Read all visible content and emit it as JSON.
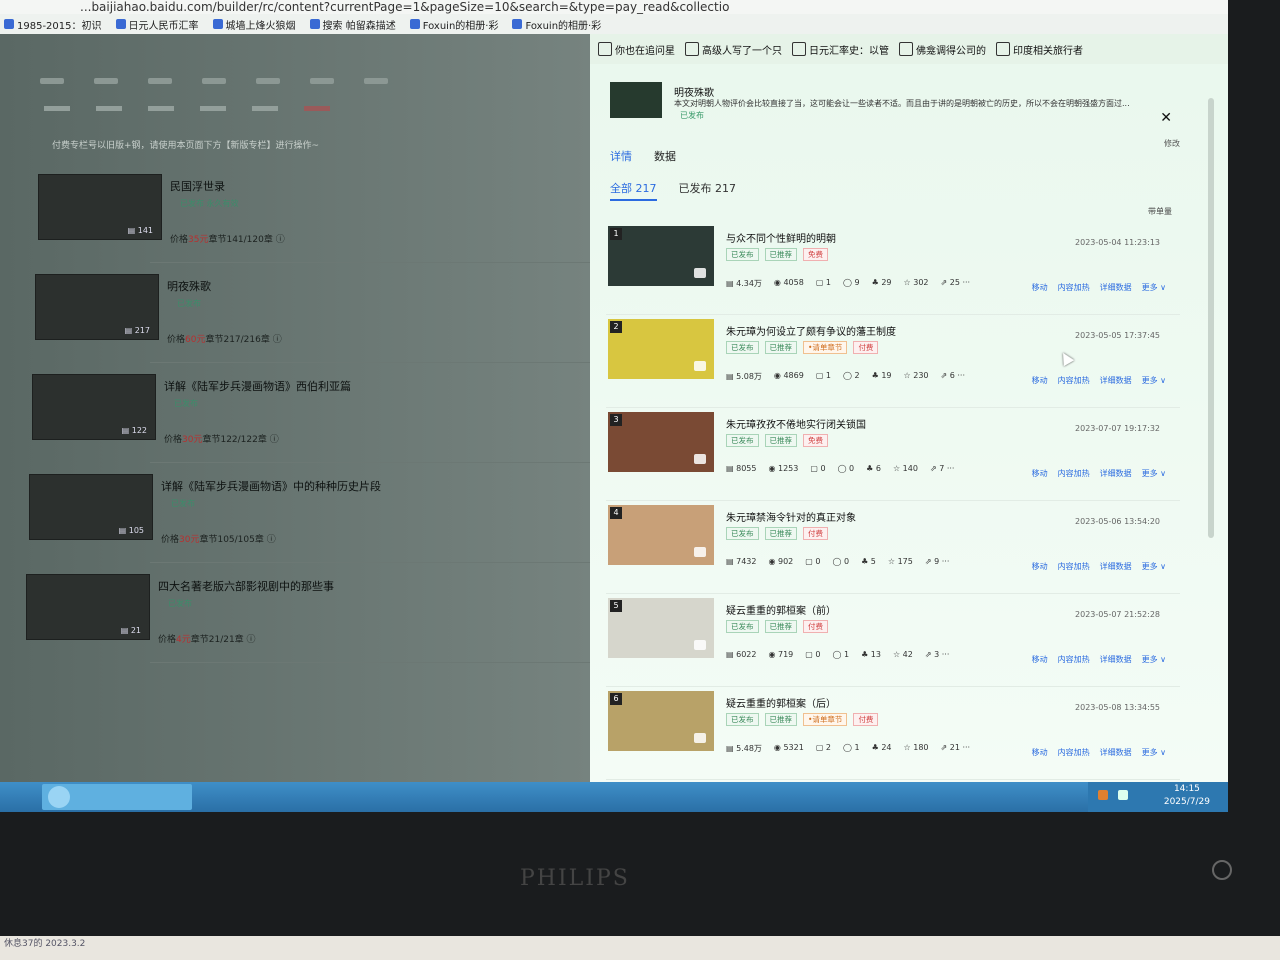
{
  "browser": {
    "url": "...baijiahao.baidu.com/builder/rc/content?currentPage=1&pageSize=10&search=&type=pay_read&collectio",
    "bookmarks": [
      "1985-2015：初识",
      "日元人民币汇率",
      "城墙上烽火狼烟",
      "搜索 帕留森描述",
      "Foxuin的相册·彩",
      "Foxuin的相册·彩"
    ],
    "toolbar_items": [
      "你也在追问星",
      "高级人写了一个只",
      "日元汇率史：以管",
      "佛龛调得公司的",
      "印度相关旅行者"
    ]
  },
  "left": {
    "hint": "付费专栏号以旧版+钢，请使用本页面下方【新版专栏】进行操作~",
    "books": [
      {
        "title": "民国浮世录",
        "status": "已发布",
        "status2": "永久有效",
        "price_prefix": "价格",
        "price": "35元",
        "chapters": "章节141/120章",
        "count": "141"
      },
      {
        "title": "明夜殊歌",
        "status": "已发布",
        "price_prefix": "价格",
        "price": "60元",
        "chapters": "章节217/216章",
        "count": "217"
      },
      {
        "title": "详解《陆军步兵漫画物语》西伯利亚篇",
        "status": "已发布",
        "price_prefix": "价格",
        "price": "30元",
        "chapters": "章节122/122章",
        "count": "122"
      },
      {
        "title": "详解《陆军步兵漫画物语》中的种种历史片段",
        "status": "已发布",
        "price_prefix": "价格",
        "price": "30元",
        "chapters": "章节105/105章",
        "count": "105"
      },
      {
        "title": "四大名著老版六部影视剧中的那些事",
        "status": "已发布",
        "price_prefix": "价格",
        "price": "4元",
        "chapters": "章节21/21章",
        "count": "21"
      }
    ]
  },
  "panel": {
    "title": "明夜殊歌",
    "desc": "本文对明朝人物评价会比较直接了当，这可能会让一些读者不适。而且由于讲的是明朝被亡的历史，所以不会在明朝强盛方面过...",
    "badge": "已发布",
    "edit": "修改",
    "tabs": [
      "详情",
      "数据"
    ],
    "filters": [
      "全部 217",
      "已发布 217"
    ],
    "sort": "带单量",
    "actions": [
      "移动",
      "内容加热",
      "详细数据",
      "更多 ∨"
    ],
    "articles": [
      {
        "idx": "1",
        "title": "与众不同个性鲜明的明朝",
        "tags": [
          "已发布",
          "已推荐",
          "免费"
        ],
        "date": "2023-05-04 11:23:13",
        "stats": [
          "4.34万",
          "4058",
          "1",
          "9",
          "29",
          "302",
          "25 ···"
        ],
        "thumb": "#2c3a36"
      },
      {
        "idx": "2",
        "title": "朱元璋为何设立了颇有争议的藩王制度",
        "tags": [
          "已发布",
          "已推荐",
          "•请单章节",
          "付费"
        ],
        "date": "2023-05-05 17:37:45",
        "stats": [
          "5.08万",
          "4869",
          "1",
          "2",
          "19",
          "230",
          "6 ···"
        ],
        "thumb": "#d8c640"
      },
      {
        "idx": "3",
        "title": "朱元璋孜孜不倦地实行闭关锁国",
        "tags": [
          "已发布",
          "已推荐",
          "免费"
        ],
        "date": "2023-07-07 19:17:32",
        "stats": [
          "8055",
          "1253",
          "0",
          "0",
          "6",
          "140",
          "7 ···"
        ],
        "thumb": "#7a4a34"
      },
      {
        "idx": "4",
        "title": "朱元璋禁海令针对的真正对象",
        "tags": [
          "已发布",
          "已推荐",
          "付费"
        ],
        "date": "2023-05-06 13:54:20",
        "stats": [
          "7432",
          "902",
          "0",
          "0",
          "5",
          "175",
          "9 ···"
        ],
        "thumb": "#c8a078"
      },
      {
        "idx": "5",
        "title": "疑云重重的郭桓案（前）",
        "tags": [
          "已发布",
          "已推荐",
          "付费"
        ],
        "date": "2023-05-07 21:52:28",
        "stats": [
          "6022",
          "719",
          "0",
          "1",
          "13",
          "42",
          "3 ···"
        ],
        "thumb": "#d6d6cc"
      },
      {
        "idx": "6",
        "title": "疑云重重的郭桓案（后）",
        "tags": [
          "已发布",
          "已推荐",
          "•请单章节",
          "付费"
        ],
        "date": "2023-05-08 13:34:55",
        "stats": [
          "5.48万",
          "5321",
          "2",
          "1",
          "24",
          "180",
          "21 ···"
        ],
        "thumb": "#b8a268"
      }
    ]
  },
  "taskbar": {
    "time": "14:15",
    "date": "2025/7/29"
  },
  "monitor": {
    "brand": "PHILIPS"
  },
  "paper_note": "休息37的 2023.3.2"
}
